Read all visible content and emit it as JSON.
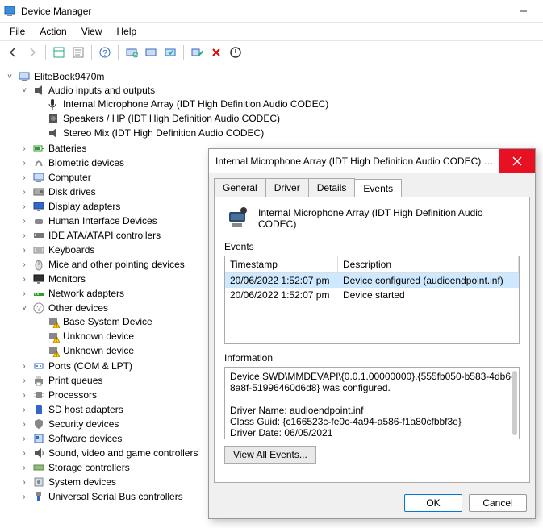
{
  "window": {
    "title": "Device Manager",
    "menus": [
      "File",
      "Action",
      "View",
      "Help"
    ]
  },
  "tree": {
    "root": "EliteBook9470m",
    "audio": {
      "label": "Audio inputs and outputs",
      "children": [
        "Internal Microphone Array (IDT High Definition Audio CODEC)",
        "Speakers / HP (IDT High Definition Audio CODEC)",
        "Stereo Mix (IDT High Definition Audio CODEC)"
      ]
    },
    "categories": [
      "Batteries",
      "Biometric devices",
      "Computer",
      "Disk drives",
      "Display adapters",
      "Human Interface Devices",
      "IDE ATA/ATAPI controllers",
      "Keyboards",
      "Mice and other pointing devices",
      "Monitors",
      "Network adapters"
    ],
    "other": {
      "label": "Other devices",
      "children": [
        "Base System Device",
        "Unknown device",
        "Unknown device"
      ]
    },
    "categories2": [
      "Ports (COM & LPT)",
      "Print queues",
      "Processors",
      "SD host adapters",
      "Security devices",
      "Software devices",
      "Sound, video and game controllers",
      "Storage controllers",
      "System devices",
      "Universal Serial Bus controllers"
    ]
  },
  "dialog": {
    "title": "Internal Microphone Array (IDT High Definition Audio CODEC) Pro...",
    "tabs": [
      "General",
      "Driver",
      "Details",
      "Events"
    ],
    "active_tab": 3,
    "device_name": "Internal Microphone Array (IDT High Definition Audio CODEC)",
    "events_label": "Events",
    "col_ts": "Timestamp",
    "col_desc": "Description",
    "events": [
      {
        "ts": "20/06/2022 1:52:07 pm",
        "desc": "Device configured (audioendpoint.inf)",
        "selected": true
      },
      {
        "ts": "20/06/2022 1:52:07 pm",
        "desc": "Device started",
        "selected": false
      }
    ],
    "info_label": "Information",
    "info_lines": [
      "Device SWD\\MMDEVAPI\\{0.0.1.00000000}.{555fb050-b583-4db6-",
      "8a8f-51996460d6d8} was configured.",
      "",
      "Driver Name: audioendpoint.inf",
      "Class Guid: {c166523c-fe0c-4a94-a586-f1a80cfbbf3e}",
      "Driver Date: 06/05/2021"
    ],
    "view_all": "View All Events...",
    "ok": "OK",
    "cancel": "Cancel"
  }
}
